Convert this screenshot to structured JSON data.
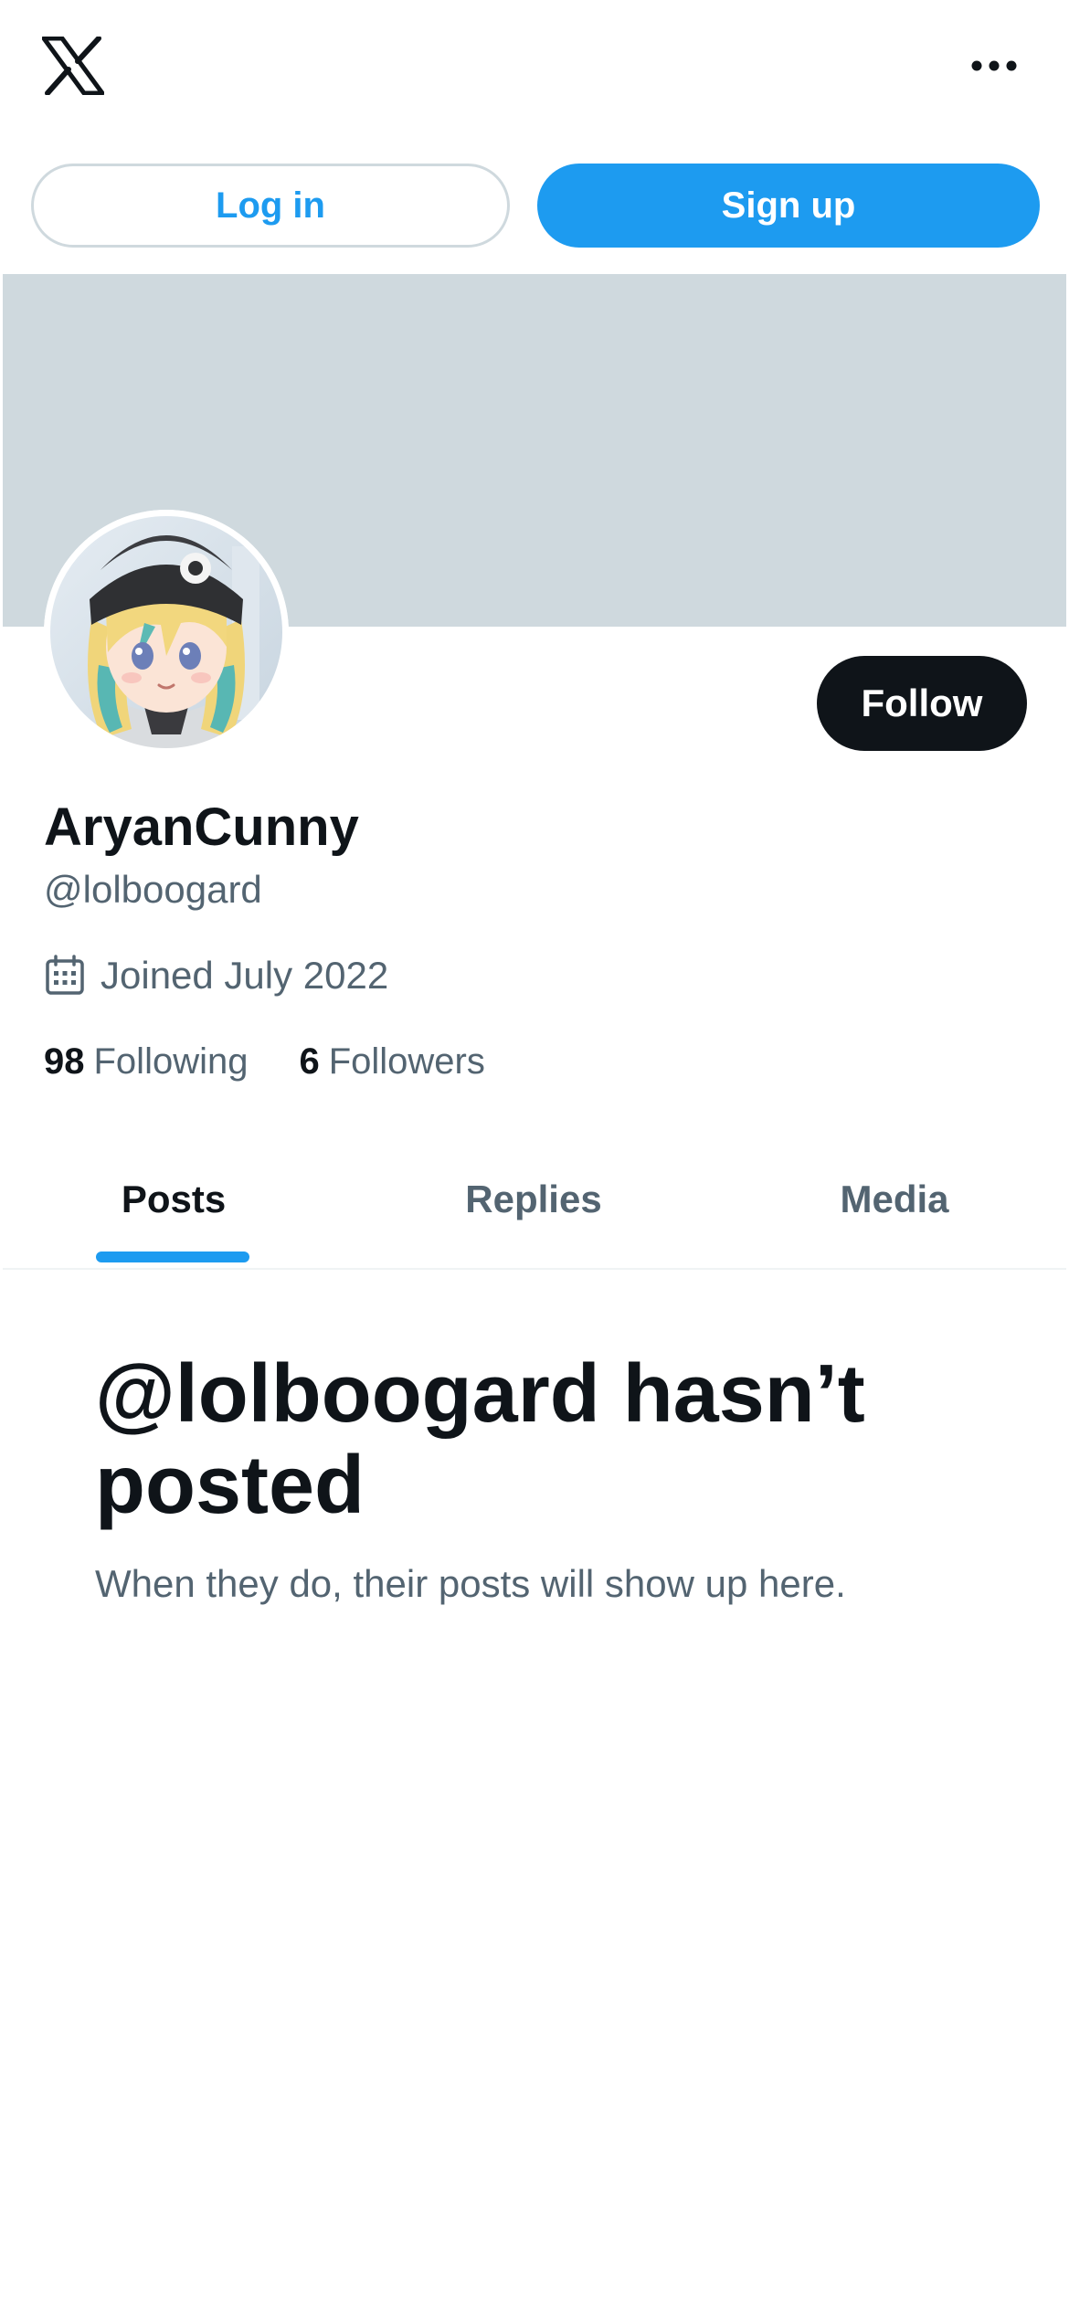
{
  "header": {
    "logo_icon": "x-logo-icon",
    "more_icon": "more-horizontal-icon"
  },
  "auth": {
    "login_label": "Log in",
    "signup_label": "Sign up"
  },
  "profile": {
    "display_name": "AryanCunny",
    "handle": "@lolboogard",
    "joined": "Joined July 2022",
    "joined_icon": "calendar-icon",
    "follow_label": "Follow",
    "following_count": "98",
    "following_label": "Following",
    "followers_count": "6",
    "followers_label": "Followers"
  },
  "tabs": [
    {
      "label": "Posts",
      "active": true
    },
    {
      "label": "Replies",
      "active": false
    },
    {
      "label": "Media",
      "active": false
    }
  ],
  "empty_state": {
    "title": "@lolboogard hasn’t posted",
    "subtitle": "When they do, their posts will show up here."
  },
  "colors": {
    "accent": "#1d9bf0",
    "text_primary": "#0f1419",
    "text_secondary": "#536471",
    "banner": "#cfd9de"
  }
}
